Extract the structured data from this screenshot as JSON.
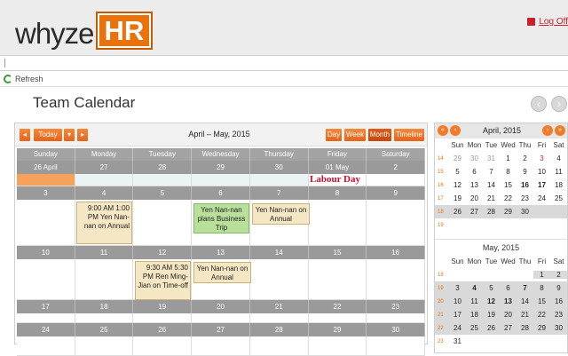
{
  "header": {
    "logo_text": "whyze",
    "logo_badge": "HR",
    "logoff_label": "Log Off",
    "logoff_icon": "logoff-icon",
    "accent": "#e8730c"
  },
  "toolbar": {
    "refresh_label": "Refresh",
    "refresh_icon": "refresh-icon"
  },
  "page": {
    "title": "Team Calendar",
    "prev_icon": "arrow-left-circle-icon",
    "next_icon": "arrow-right-circle-icon"
  },
  "calendar": {
    "prev_label": "◂",
    "today_label": "Today",
    "today_drop": "▾",
    "next_label": "▸",
    "range": "April – May, 2015",
    "views": [
      "Day",
      "Week",
      "Month",
      "Timeline"
    ],
    "active_view": "Month",
    "weekdays": [
      "Sunday",
      "Monday",
      "Tuesday",
      "Wednesday",
      "Thursday",
      "Friday",
      "Saturday"
    ],
    "weeks": [
      [
        "26 April",
        "27",
        "28",
        "29",
        "30",
        "01 May",
        "2"
      ],
      [
        "3",
        "4",
        "5",
        "6",
        "7",
        "8",
        "9"
      ],
      [
        "10",
        "11",
        "12",
        "13",
        "14",
        "15",
        "16"
      ],
      [
        "17",
        "18",
        "19",
        "20",
        "21",
        "22",
        "23"
      ],
      [
        "24",
        "25",
        "26",
        "27",
        "28",
        "29",
        "30"
      ]
    ],
    "holiday": "Labour Day",
    "events": {
      "e1": "9:00 AM 1:00 PM Yen Nan-nan on Annual",
      "e2": "Yen Nan-nan plans Business Trip",
      "e3": "Yen Nan-nan on Annual",
      "e4": "9:30 AM 5:30 PM Ren Ming-Jian on Time-off",
      "e5": "Yen Nan-nan on Annual"
    }
  },
  "mini_april": {
    "title": "April, 2015",
    "dow": [
      "Sun",
      "Mon",
      "Tue",
      "Wed",
      "Thu",
      "Fri",
      "Sat"
    ],
    "weeks": [
      "14",
      "15",
      "16",
      "17",
      "18",
      "19"
    ],
    "rows": [
      [
        "29",
        "30",
        "31",
        "1",
        "2",
        "3",
        "4"
      ],
      [
        "5",
        "6",
        "7",
        "8",
        "9",
        "10",
        "11"
      ],
      [
        "12",
        "13",
        "14",
        "15",
        "16",
        "17",
        "18"
      ],
      [
        "19",
        "20",
        "21",
        "22",
        "23",
        "24",
        "25"
      ],
      [
        "26",
        "27",
        "28",
        "29",
        "30",
        "",
        ""
      ],
      [
        "",
        "",
        "",
        "",
        "",
        "",
        ""
      ]
    ]
  },
  "mini_may": {
    "title": "May, 2015",
    "dow": [
      "Sun",
      "Mon",
      "Tue",
      "Wed",
      "Thu",
      "Fri",
      "Sat"
    ],
    "weeks": [
      "18",
      "19",
      "20",
      "21",
      "22",
      "23"
    ],
    "rows": [
      [
        "",
        "",
        "",
        "",
        "",
        "1",
        "2"
      ],
      [
        "3",
        "4",
        "5",
        "6",
        "7",
        "8",
        "9"
      ],
      [
        "10",
        "11",
        "12",
        "13",
        "14",
        "15",
        "16"
      ],
      [
        "17",
        "18",
        "19",
        "20",
        "21",
        "22",
        "23"
      ],
      [
        "24",
        "25",
        "26",
        "27",
        "28",
        "29",
        "30"
      ],
      [
        "31",
        "",
        "",
        "",
        "",
        "",
        ""
      ]
    ]
  }
}
